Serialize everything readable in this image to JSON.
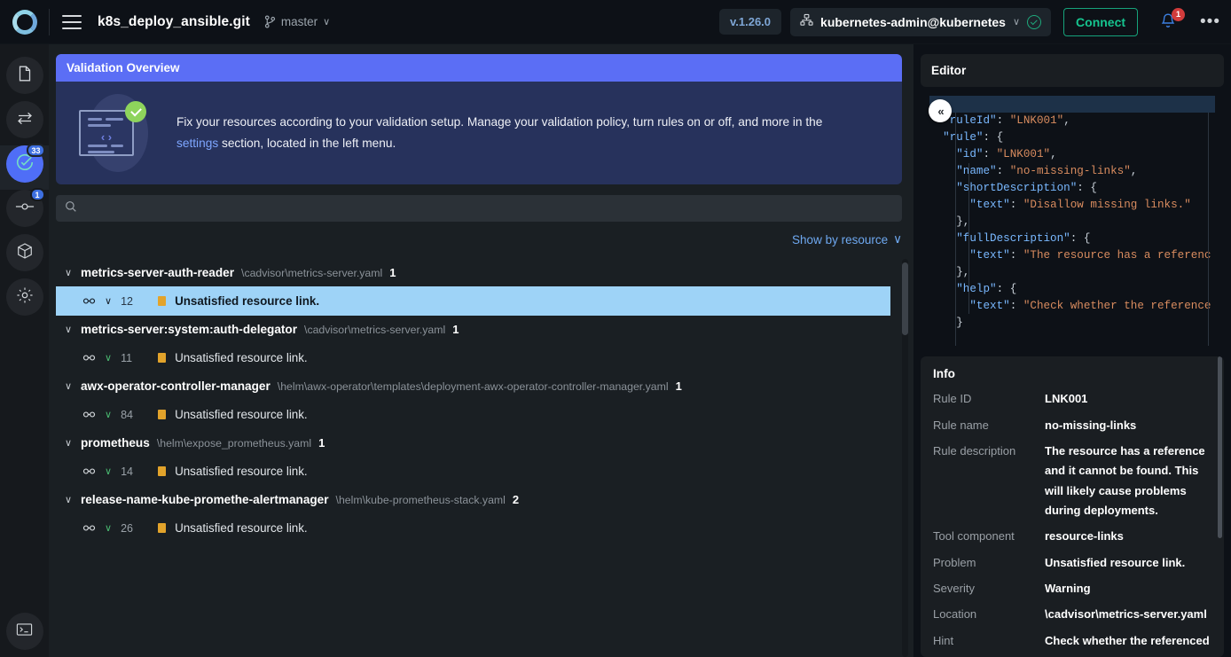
{
  "topbar": {
    "logo": "monokle-logo",
    "menu_icon": "hamburger-menu-icon",
    "repo_title": "k8s_deploy_ansible.git",
    "branch_icon": "git-branch-icon",
    "branch_name": "master",
    "branch_caret": "∨",
    "version": "v.1.26.0",
    "cluster_icon": "cluster-icon",
    "cluster_name": "kubernetes-admin@kubernetes",
    "cluster_caret": "∨",
    "cluster_status_icon": "check-circle-icon",
    "connect_label": "Connect",
    "bell_icon": "bell-icon",
    "bell_badge": "1",
    "kebab_icon": "more-options-icon",
    "kebab_glyph": "•••"
  },
  "rail": {
    "items": [
      {
        "name": "file-icon",
        "badge": ""
      },
      {
        "name": "compare-arrows-icon",
        "badge": ""
      },
      {
        "name": "validation-check-icon",
        "badge": "33",
        "selected": true
      },
      {
        "name": "git-commit-icon",
        "badge": "1"
      },
      {
        "name": "package-cube-icon",
        "badge": ""
      },
      {
        "name": "settings-gear-icon",
        "badge": ""
      }
    ],
    "bottom": {
      "name": "terminal-icon"
    }
  },
  "overview": {
    "title": "Validation Overview",
    "art_icon": "code-validated-icon",
    "text_part1": "Fix your resources according to your validation setup. Manage your validation policy, turn rules on or off, and more in the ",
    "link_label": "settings",
    "text_part2": " section, located in the left menu.",
    "code_glyph": "‹ ›"
  },
  "search": {
    "icon": "search-icon",
    "value": "",
    "placeholder": ""
  },
  "showby": {
    "label": "Show by resource",
    "caret": "∨",
    "icon": "chevron-down-icon"
  },
  "collapse_button": {
    "icon": "chevron-double-left-icon",
    "glyph": "«"
  },
  "results": {
    "groups": [
      {
        "name": "metrics-server-auth-reader",
        "path": "\\cadvisor\\metrics-server.yaml",
        "count": "1",
        "rows": [
          {
            "line": "12",
            "severity_color": "#e2a32b",
            "text": "Unsatisfied resource link.",
            "selected": true
          }
        ]
      },
      {
        "name": "metrics-server:system:auth-delegator",
        "path": "\\cadvisor\\metrics-server.yaml",
        "count": "1",
        "rows": [
          {
            "line": "11",
            "severity_color": "#e2a32b",
            "text": "Unsatisfied resource link.",
            "selected": false
          }
        ]
      },
      {
        "name": "awx-operator-controller-manager",
        "path": "\\helm\\awx-operator\\templates\\deployment-awx-operator-controller-manager.yaml",
        "count": "1",
        "rows": [
          {
            "line": "84",
            "severity_color": "#e2a32b",
            "text": "Unsatisfied resource link.",
            "selected": false
          }
        ]
      },
      {
        "name": "prometheus",
        "path": "\\helm\\expose_prometheus.yaml",
        "count": "1",
        "rows": [
          {
            "line": "14",
            "severity_color": "#e2a32b",
            "text": "Unsatisfied resource link.",
            "selected": false
          }
        ]
      },
      {
        "name": "release-name-kube-promethe-alertmanager",
        "path": "\\helm\\kube-prometheus-stack.yaml",
        "count": "2",
        "rows": [
          {
            "line": "26",
            "severity_color": "#e2a32b",
            "text": "Unsatisfied resource link.",
            "selected": false
          }
        ]
      }
    ],
    "group_chevron": "∨",
    "row_chevron": "∨",
    "link_icon": "link-icon"
  },
  "editor": {
    "title": "Editor",
    "lines": [
      [
        {
          "t": "{",
          "c": "p"
        }
      ],
      [
        {
          "t": "  ",
          "c": "p"
        },
        {
          "t": "\"ruleId\"",
          "c": "k"
        },
        {
          "t": ": ",
          "c": "p"
        },
        {
          "t": "\"LNK001\"",
          "c": "s"
        },
        {
          "t": ",",
          "c": "p"
        }
      ],
      [
        {
          "t": "  ",
          "c": "p"
        },
        {
          "t": "\"rule\"",
          "c": "k"
        },
        {
          "t": ": {",
          "c": "p"
        }
      ],
      [
        {
          "t": "    ",
          "c": "p"
        },
        {
          "t": "\"id\"",
          "c": "k"
        },
        {
          "t": ": ",
          "c": "p"
        },
        {
          "t": "\"LNK001\"",
          "c": "s"
        },
        {
          "t": ",",
          "c": "p"
        }
      ],
      [
        {
          "t": "    ",
          "c": "p"
        },
        {
          "t": "\"name\"",
          "c": "k"
        },
        {
          "t": ": ",
          "c": "p"
        },
        {
          "t": "\"no-missing-links\"",
          "c": "s"
        },
        {
          "t": ",",
          "c": "p"
        }
      ],
      [
        {
          "t": "    ",
          "c": "p"
        },
        {
          "t": "\"shortDescription\"",
          "c": "k"
        },
        {
          "t": ": {",
          "c": "p"
        }
      ],
      [
        {
          "t": "      ",
          "c": "p"
        },
        {
          "t": "\"text\"",
          "c": "k"
        },
        {
          "t": ": ",
          "c": "p"
        },
        {
          "t": "\"Disallow missing links.\"",
          "c": "s"
        }
      ],
      [
        {
          "t": "    },",
          "c": "p"
        }
      ],
      [
        {
          "t": "    ",
          "c": "p"
        },
        {
          "t": "\"fullDescription\"",
          "c": "k"
        },
        {
          "t": ": {",
          "c": "p"
        }
      ],
      [
        {
          "t": "      ",
          "c": "p"
        },
        {
          "t": "\"text\"",
          "c": "k"
        },
        {
          "t": ": ",
          "c": "p"
        },
        {
          "t": "\"The resource has a referenc",
          "c": "s"
        }
      ],
      [
        {
          "t": "    },",
          "c": "p"
        }
      ],
      [
        {
          "t": "    ",
          "c": "p"
        },
        {
          "t": "\"help\"",
          "c": "k"
        },
        {
          "t": ": {",
          "c": "p"
        }
      ],
      [
        {
          "t": "      ",
          "c": "p"
        },
        {
          "t": "\"text\"",
          "c": "k"
        },
        {
          "t": ": ",
          "c": "p"
        },
        {
          "t": "\"Check whether the reference",
          "c": "s"
        }
      ],
      [
        {
          "t": "    }",
          "c": "p"
        }
      ]
    ]
  },
  "info": {
    "title": "Info",
    "fields": [
      {
        "key": "Rule ID",
        "value": "LNK001"
      },
      {
        "key": "Rule name",
        "value": "no-missing-links"
      },
      {
        "key": "Rule description",
        "value": "The resource has a reference and it cannot be found. This will likely cause problems during deployments."
      },
      {
        "key": "Tool component",
        "value": "resource-links"
      },
      {
        "key": "Problem",
        "value": "Unsatisfied resource link."
      },
      {
        "key": "Severity",
        "value": "Warning"
      },
      {
        "key": "Location",
        "value": "\\cadvisor\\metrics-server.yaml"
      },
      {
        "key": "Hint",
        "value": "Check whether the referenced"
      }
    ]
  },
  "colors": {
    "accent_blue": "#5b6ef5",
    "link_blue": "#6ea8f0",
    "selection_blue": "#9ed3f7",
    "warning_amber": "#e2a32b",
    "connect_green": "#16c48f",
    "badge_red": "#d23c3c",
    "panel_bg": "#1a1f23",
    "app_bg": "#0d1117"
  }
}
